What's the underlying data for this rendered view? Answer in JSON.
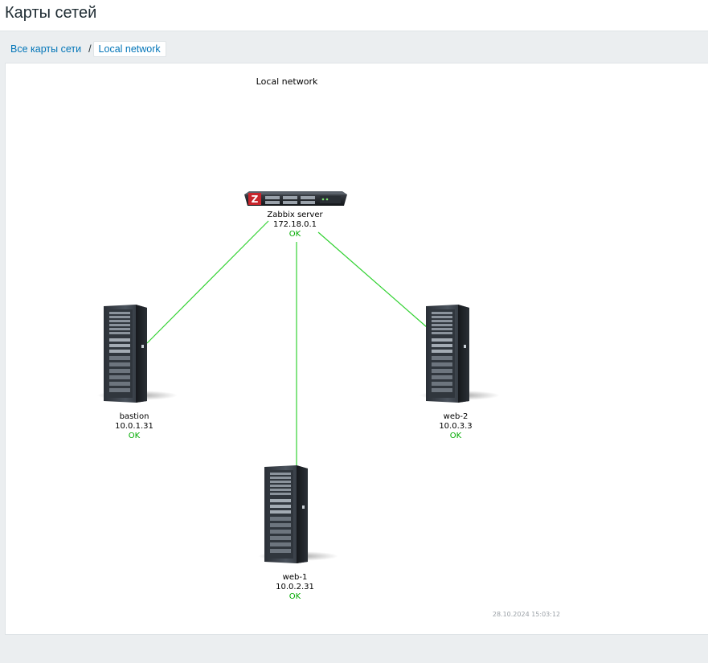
{
  "header": {
    "title": "Карты сетей"
  },
  "breadcrumb": {
    "all_maps": "Все карты сети",
    "separator": "/",
    "current": "Local network"
  },
  "map": {
    "title": "Local network",
    "timestamp": "28.10.2024 15:03:12",
    "link_color": "#33d233",
    "status_color": "#00aa00",
    "hosts": {
      "zabbix": {
        "name": "Zabbix server",
        "ip": "172.18.0.1",
        "status": "OK",
        "icon": "rack-server-icon"
      },
      "bastion": {
        "name": "bastion",
        "ip": "10.0.1.31",
        "status": "OK",
        "icon": "tower-server-icon"
      },
      "web2": {
        "name": "web-2",
        "ip": "10.0.3.3",
        "status": "OK",
        "icon": "tower-server-icon"
      },
      "web1": {
        "name": "web-1",
        "ip": "10.0.2.31",
        "status": "OK",
        "icon": "tower-server-icon"
      }
    }
  }
}
